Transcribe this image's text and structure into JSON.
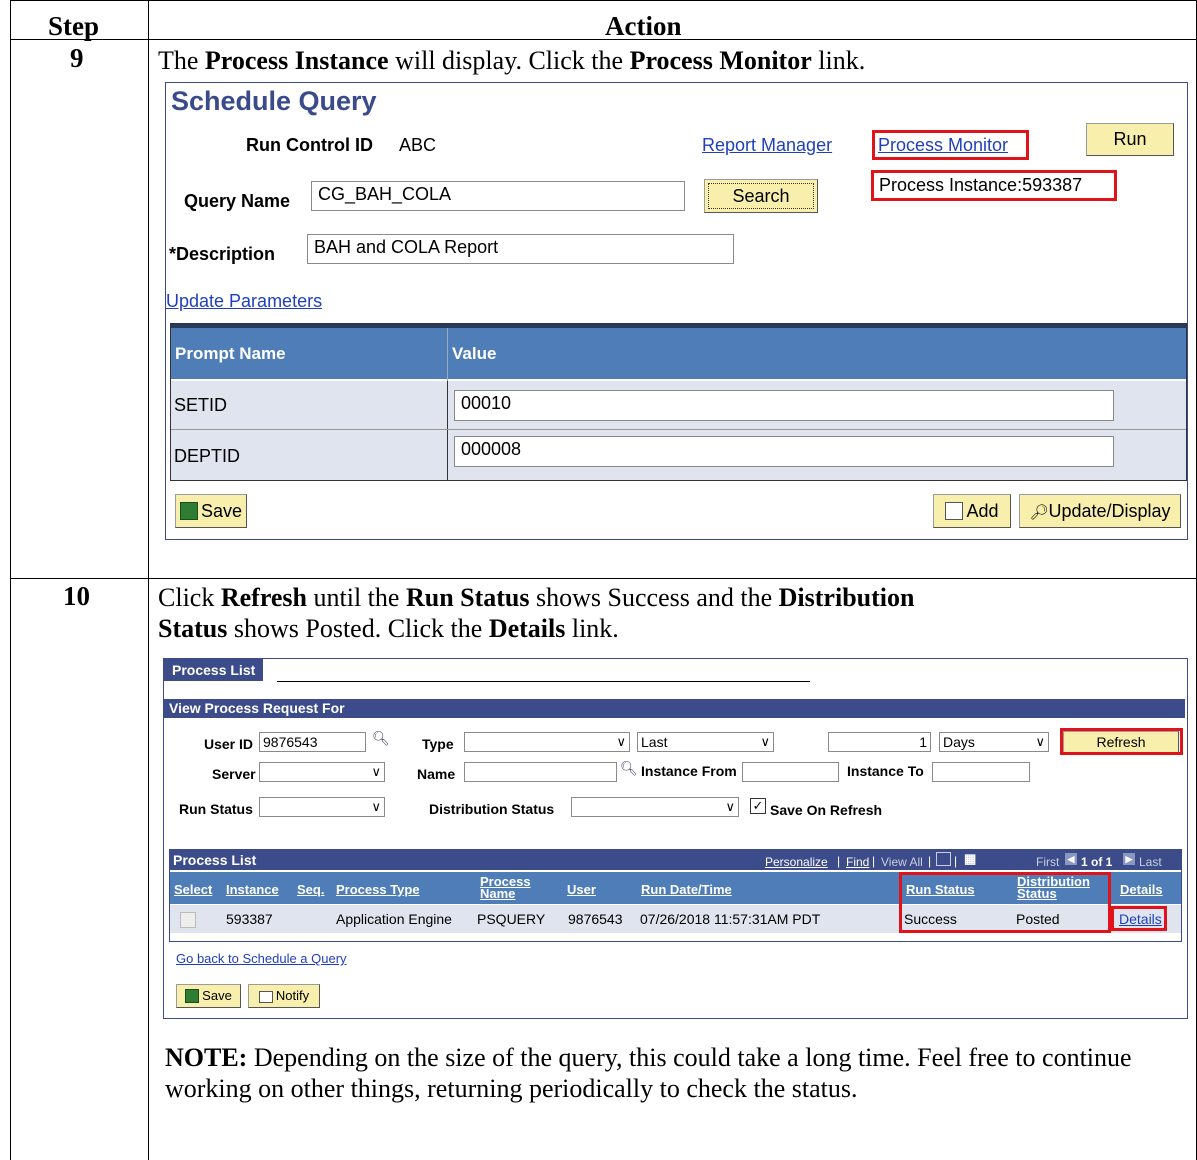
{
  "table": {
    "step_header": "Step",
    "action_header": "Action"
  },
  "step9": {
    "number": "9",
    "instruction_parts": [
      "The ",
      "Process Instance",
      " will display. Click the ",
      "Process Monitor",
      " link."
    ],
    "panel": {
      "title": "Schedule Query",
      "run_control_label": "Run Control ID",
      "run_control_value": "ABC",
      "report_manager_link": "Report Manager",
      "process_monitor_link": "Process Monitor",
      "run_button": "Run",
      "process_instance_text": "Process Instance:593387",
      "query_name_label": "Query Name",
      "query_name_value": "CG_BAH_COLA",
      "search_button": "Search",
      "description_label": "*Description",
      "description_value": "BAH and COLA Report",
      "update_parameters_link": "Update Parameters",
      "grid_headers": [
        "Prompt Name",
        "Value"
      ],
      "grid_rows": [
        {
          "prompt": "SETID",
          "value": "00010"
        },
        {
          "prompt": "DEPTID",
          "value": "000008"
        }
      ],
      "save_button": "Save",
      "add_button": "Add",
      "update_display_button": "Update/Display"
    }
  },
  "step10": {
    "number": "10",
    "line1_parts": [
      "Click ",
      "Refresh",
      " until the ",
      "Run Status",
      " shows Success and the ",
      "Distribution"
    ],
    "line2_parts": [
      "Status",
      " shows Posted. Click the ",
      "Details",
      " link."
    ],
    "panel": {
      "tab_label": "Process List",
      "view_bar": "View Process Request For",
      "user_id_label": "User ID",
      "user_id_value": "9876543",
      "type_label": "Type",
      "type_value": "",
      "last_value": "Last",
      "days_count": "1",
      "days_value": "Days",
      "refresh_button": "Refresh",
      "server_label": "Server",
      "name_label": "Name",
      "instance_from_label": "Instance From",
      "instance_to_label": "Instance To",
      "run_status_label": "Run Status",
      "distribution_status_label": "Distribution Status",
      "save_on_refresh_label": "Save On Refresh",
      "list_title": "Process List",
      "nav_personalize": "Personalize",
      "nav_find": "Find",
      "nav_view_all": "View All",
      "nav_first": "First",
      "nav_count": "1 of 1",
      "nav_last": "Last",
      "columns": {
        "select": "Select",
        "instance": "Instance",
        "seq": "Seq.",
        "process_type": "Process Type",
        "process_name_1": "Process",
        "process_name_2": "Name",
        "user": "User",
        "run_date": "Run Date/Time",
        "run_status": "Run Status",
        "dist_status_1": "Distribution",
        "dist_status_2": "Status",
        "details": "Details"
      },
      "row": {
        "instance": "593387",
        "process_type": "Application Engine",
        "process_name": "PSQUERY",
        "user": "9876543",
        "run_date": "07/26/2018 11:57:31AM PDT",
        "run_status": "Success",
        "dist_status": "Posted",
        "details": "Details"
      },
      "go_back_link": "Go back to Schedule a Query",
      "save_button": "Save",
      "notify_button": "Notify"
    },
    "note_label": "NOTE:",
    "note_text": " Depending on the size of the query, this could take a long time. Feel free to continue working on other things, returning periodically to check the status."
  }
}
